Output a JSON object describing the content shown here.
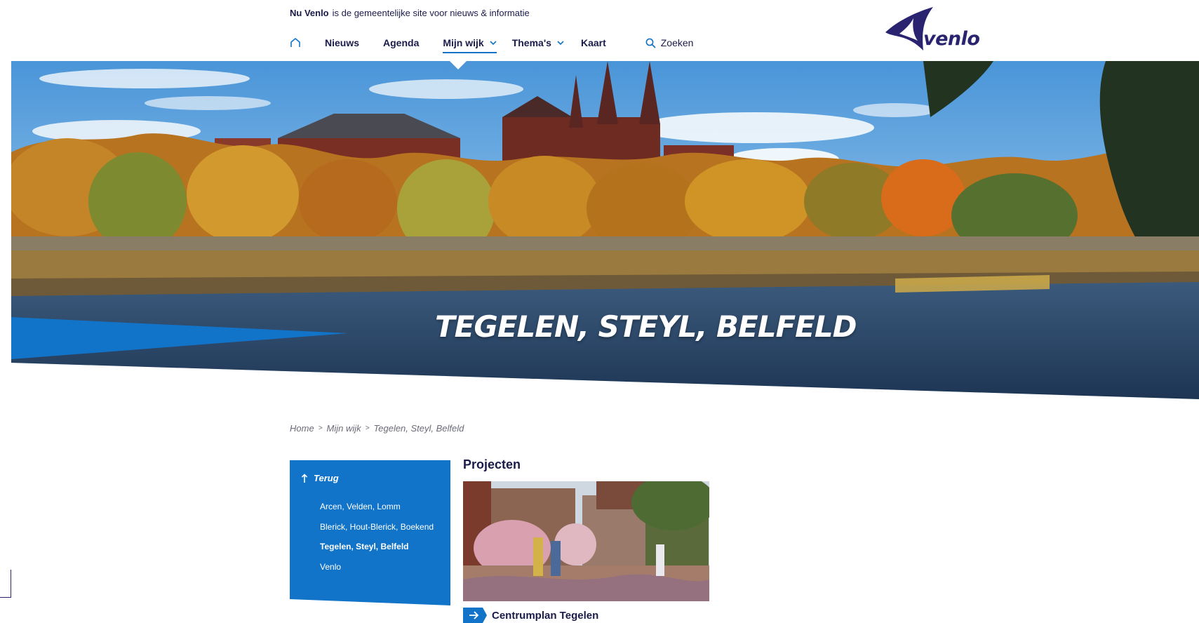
{
  "header": {
    "brand": "Nu Venlo",
    "tagline": "is de gemeentelijke site voor nieuws & informatie",
    "logo_text": "venlo"
  },
  "nav": {
    "home_icon": "home-icon",
    "items": [
      {
        "label": "Nieuws"
      },
      {
        "label": "Agenda"
      },
      {
        "label": "Mijn wijk",
        "active": true
      },
      {
        "label": "Thema's"
      },
      {
        "label": "Kaart"
      }
    ],
    "search_label": "Zoeken"
  },
  "hero": {
    "title": "TEGELEN, STEYL, BELFELD"
  },
  "breadcrumb": [
    "Home",
    "Mijn wijk",
    "Tegelen, Steyl, Belfeld"
  ],
  "sidebar": {
    "back_label": "Terug",
    "items": [
      {
        "label": "Arcen, Velden, Lomm"
      },
      {
        "label": "Blerick, Hout-Blerick, Boekend"
      },
      {
        "label": "Tegelen, Steyl, Belfeld",
        "current": true
      },
      {
        "label": "Venlo"
      }
    ]
  },
  "projects": {
    "title": "Projecten",
    "items": [
      {
        "label": "Centrumplan Tegelen"
      }
    ]
  },
  "colors": {
    "brand_blue": "#1274c8",
    "navy": "#1b1b4a",
    "logo_navy": "#2a2470"
  }
}
